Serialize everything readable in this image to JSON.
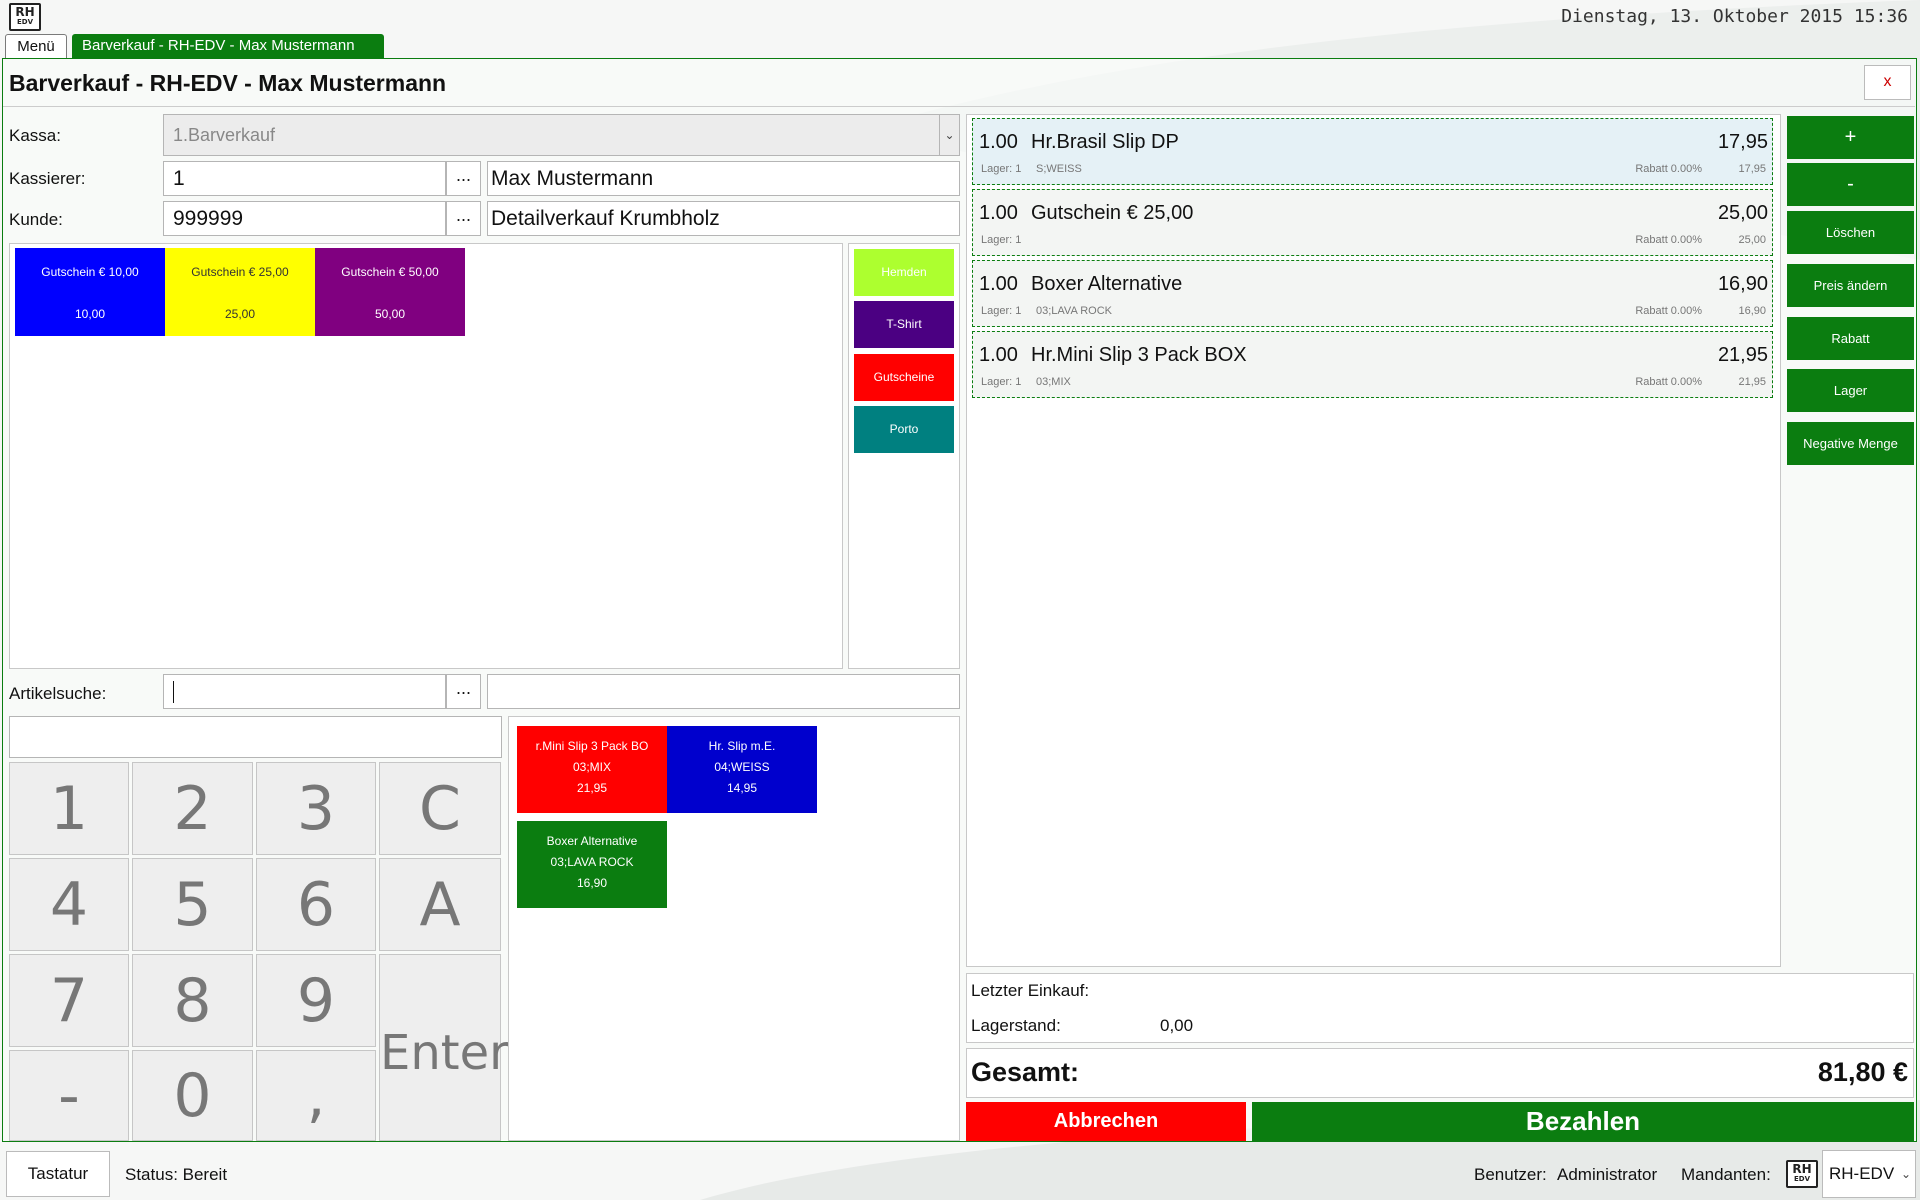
{
  "logo": {
    "top": "RH",
    "bottom": "EDV"
  },
  "datetime": "Dienstag, 13. Oktober 2015 15:36",
  "tabs": {
    "menu": "Menü",
    "active": "Barverkauf - RH-EDV - Max  Mustermann"
  },
  "window": {
    "title": "Barverkauf - RH-EDV - Max  Mustermann",
    "close": "x"
  },
  "form": {
    "kassa_label": "Kassa:",
    "kassa_value": "1.Barverkauf",
    "kassierer_label": "Kassierer:",
    "kassierer_id": "1",
    "kassierer_name": "Max  Mustermann",
    "kunde_label": "Kunde:",
    "kunde_id": "999999",
    "kunde_name": "Detailverkauf Krumbholz",
    "browse": "...",
    "artikelsuche_label": "Artikelsuche:",
    "artikelsuche_value": "",
    "artikelsuche_desc": ""
  },
  "quick_buttons": [
    {
      "title": "Gutschein € 10,00",
      "value": "10,00",
      "color": "#0000ff"
    },
    {
      "title": "Gutschein € 25,00",
      "value": "25,00",
      "color": "#ffff00"
    },
    {
      "title": "Gutschein € 50,00",
      "value": "50,00",
      "color": "#800080"
    }
  ],
  "categories": [
    {
      "label": "Hemden",
      "color": "#adff2f"
    },
    {
      "label": "T-Shirt",
      "color": "#4b0082"
    },
    {
      "label": "Gutscheine",
      "color": "#ff0000"
    },
    {
      "label": "Porto",
      "color": "#008080"
    }
  ],
  "keypad": {
    "display": "",
    "keys": [
      "1",
      "2",
      "3",
      "C",
      "4",
      "5",
      "6",
      "A",
      "7",
      "8",
      "9",
      "Enter",
      "-",
      "0",
      ","
    ]
  },
  "article_buttons": [
    {
      "line1": "r.Mini Slip 3 Pack BO",
      "line2": "03;MIX",
      "line3": "21,95",
      "color": "#ff0000"
    },
    {
      "line1": "Hr. Slip m.E.",
      "line2": "04;WEISS",
      "line3": "14,95",
      "color": "#0000cd"
    },
    {
      "line1": "Boxer Alternative",
      "line2": "03;LAVA ROCK",
      "line3": "16,90",
      "color": "#0b7d10"
    }
  ],
  "cart": [
    {
      "qty": "1.00",
      "name": "Hr.Brasil Slip DP",
      "price": "17,95",
      "lager": "Lager: 1",
      "variant": "S;WEISS",
      "rabatt": "Rabatt 0.00%",
      "subtotal": "17,95",
      "selected": true
    },
    {
      "qty": "1.00",
      "name": "Gutschein € 25,00",
      "price": "25,00",
      "lager": "Lager: 1",
      "variant": "",
      "rabatt": "Rabatt 0.00%",
      "subtotal": "25,00",
      "selected": false
    },
    {
      "qty": "1.00",
      "name": "Boxer Alternative",
      "price": "16,90",
      "lager": "Lager: 1",
      "variant": "03;LAVA ROCK",
      "rabatt": "Rabatt 0.00%",
      "subtotal": "16,90",
      "selected": false
    },
    {
      "qty": "1.00",
      "name": "Hr.Mini Slip 3 Pack BOX",
      "price": "21,95",
      "lager": "Lager: 1",
      "variant": "03;MIX",
      "rabatt": "Rabatt 0.00%",
      "subtotal": "21,95",
      "selected": false
    }
  ],
  "actions": [
    "+",
    "-",
    "Löschen",
    "Preis ändern",
    "Rabatt",
    "Lager",
    "Negative Menge"
  ],
  "info": {
    "letzter_label": "Letzter Einkauf:",
    "letzter_value": "",
    "lagerstand_label": "Lagerstand:",
    "lagerstand_value": "0,00"
  },
  "total": {
    "label": "Gesamt:",
    "value": "81,80 €"
  },
  "buttons": {
    "cancel": "Abbrechen",
    "pay": "Bezahlen"
  },
  "statusbar": {
    "keyboard": "Tastatur",
    "status": "Status: Bereit",
    "user_label": "Benutzer:",
    "user_value": "Administrator",
    "client_label": "Mandanten:",
    "client_value": "RH-EDV"
  },
  "colors": {
    "green": "#0b7d10",
    "red": "#ff0000"
  }
}
